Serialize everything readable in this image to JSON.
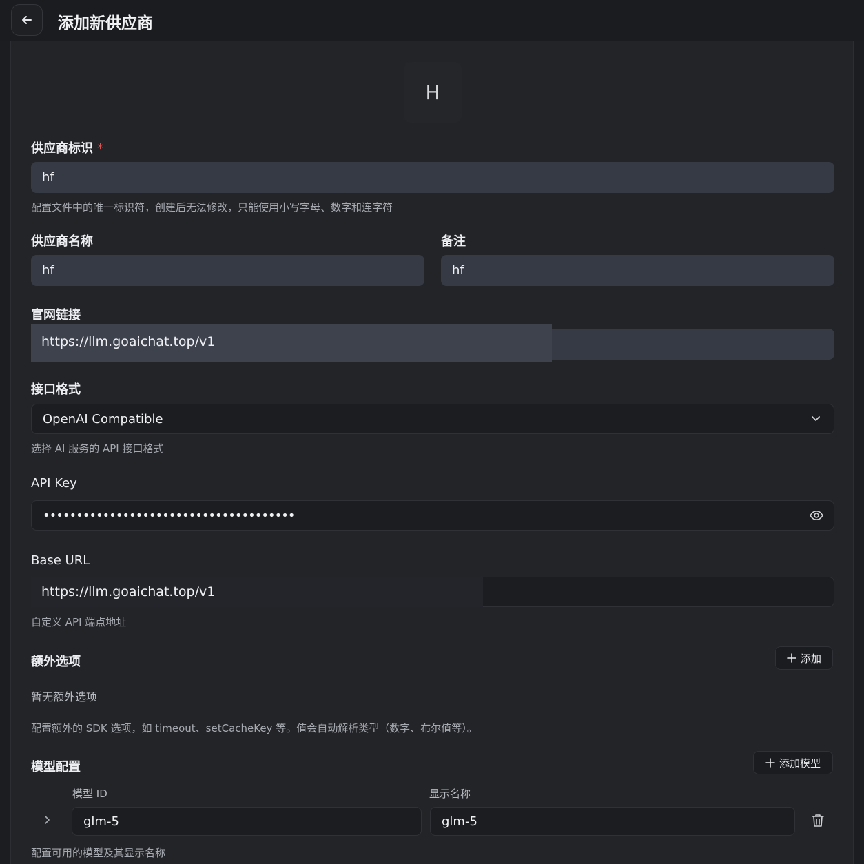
{
  "header": {
    "title": "添加新供应商"
  },
  "avatar": {
    "letter": "H"
  },
  "provider_id": {
    "label": "供应商标识",
    "required_mark": "*",
    "value": "hf",
    "hint": "配置文件中的唯一标识符，创建后无法修改，只能使用小写字母、数字和连字符"
  },
  "provider_name": {
    "label": "供应商名称",
    "value": "hf"
  },
  "note": {
    "label": "备注",
    "value": "hf"
  },
  "website": {
    "label": "官网链接",
    "value": "https://llm.goaichat.top/v1"
  },
  "api_format": {
    "label": "接口格式",
    "selected": "OpenAI Compatible",
    "hint": "选择 AI 服务的 API 接口格式"
  },
  "api_key": {
    "label": "API Key",
    "masked_value": "••••••••••••••••••••••••••••••••••••••"
  },
  "base_url": {
    "label": "Base URL",
    "value": "https://llm.goaichat.top/v1",
    "hint": "自定义 API 端点地址"
  },
  "extra_options": {
    "label": "额外选项",
    "add_button": "添加",
    "empty_text": "暂无额外选项",
    "hint": "配置额外的 SDK 选项，如 timeout、setCacheKey 等。值会自动解析类型（数字、布尔值等）。"
  },
  "models": {
    "label": "模型配置",
    "add_button": "添加模型",
    "col_id": "模型 ID",
    "col_name": "显示名称",
    "rows": [
      {
        "id": "glm-5",
        "name": "glm-5"
      }
    ],
    "hint": "配置可用的模型及其显示名称"
  },
  "colors": {
    "background": "#232428",
    "input_light": "#353a44",
    "input_dark": "#1c1d21",
    "required": "#d45454"
  }
}
